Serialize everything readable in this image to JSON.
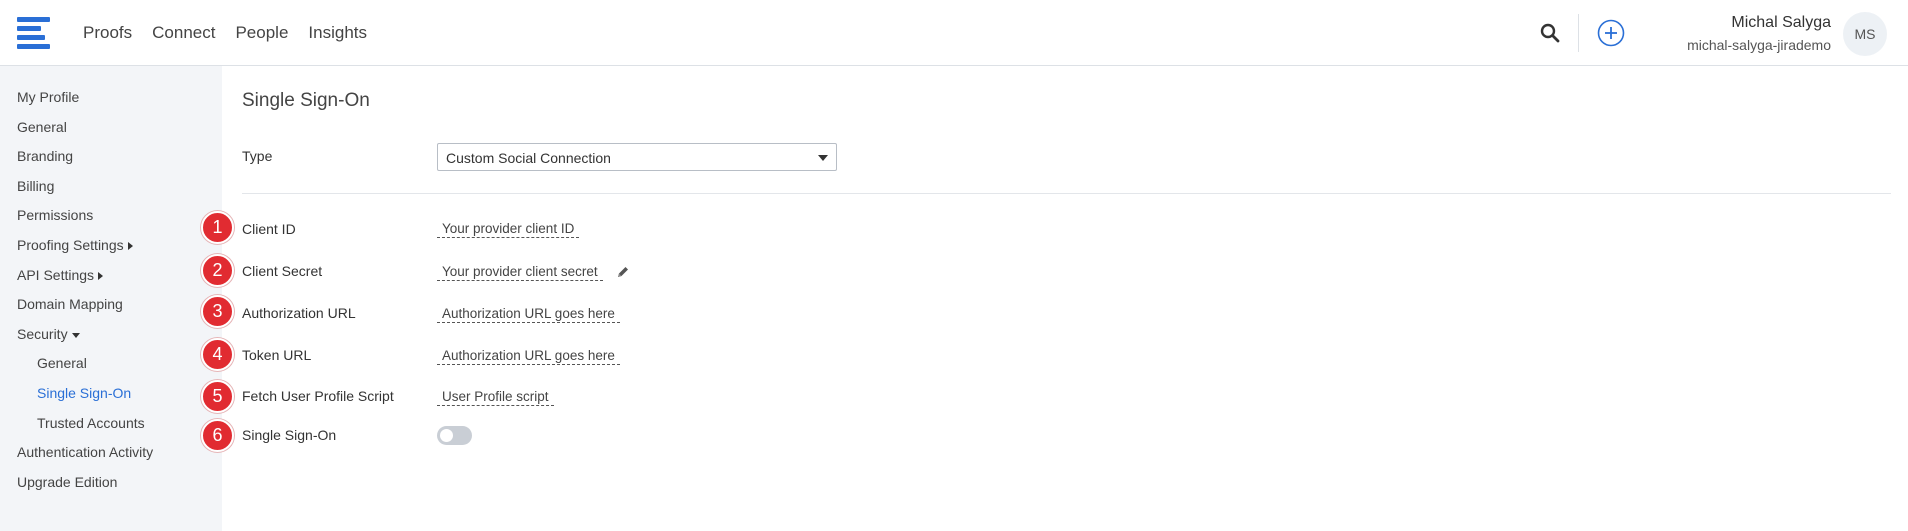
{
  "header": {
    "nav": [
      "Proofs",
      "Connect",
      "People",
      "Insights"
    ],
    "user": {
      "name": "Michal Salyga",
      "org": "michal-salyga-jirademo",
      "initials": "MS"
    },
    "icons": {
      "logo": "menu-logo-icon",
      "search": "search-icon",
      "add": "add-circle-icon"
    },
    "accent_color": "#2a6fd6"
  },
  "sidebar": {
    "items": [
      {
        "label": "My Profile"
      },
      {
        "label": "General"
      },
      {
        "label": "Branding"
      },
      {
        "label": "Billing"
      },
      {
        "label": "Permissions"
      },
      {
        "label": "Proofing Settings"
      },
      {
        "label": "API Settings"
      },
      {
        "label": "Domain Mapping"
      },
      {
        "label": "Security"
      },
      {
        "label": "General"
      },
      {
        "label": "Single Sign-On"
      },
      {
        "label": "Trusted Accounts"
      },
      {
        "label": "Authentication Activity"
      },
      {
        "label": "Upgrade Edition"
      }
    ],
    "active_color": "#2a6fd6"
  },
  "main": {
    "title": "Single Sign-On",
    "type_label": "Type",
    "type_value": "Custom Social Connection",
    "fields": [
      {
        "marker": "1",
        "label": "Client ID",
        "value": "Your provider client ID"
      },
      {
        "marker": "2",
        "label": "Client Secret",
        "value": "Your provider client secret"
      },
      {
        "marker": "3",
        "label": "Authorization URL",
        "value": "Authorization URL goes here"
      },
      {
        "marker": "4",
        "label": "Token URL",
        "value": "Authorization URL goes here"
      },
      {
        "marker": "5",
        "label": "Fetch User Profile Script",
        "value": "User Profile script"
      },
      {
        "marker": "6",
        "label": "Single Sign-On",
        "toggle_on": false
      }
    ],
    "marker_color": "#e12b31"
  }
}
